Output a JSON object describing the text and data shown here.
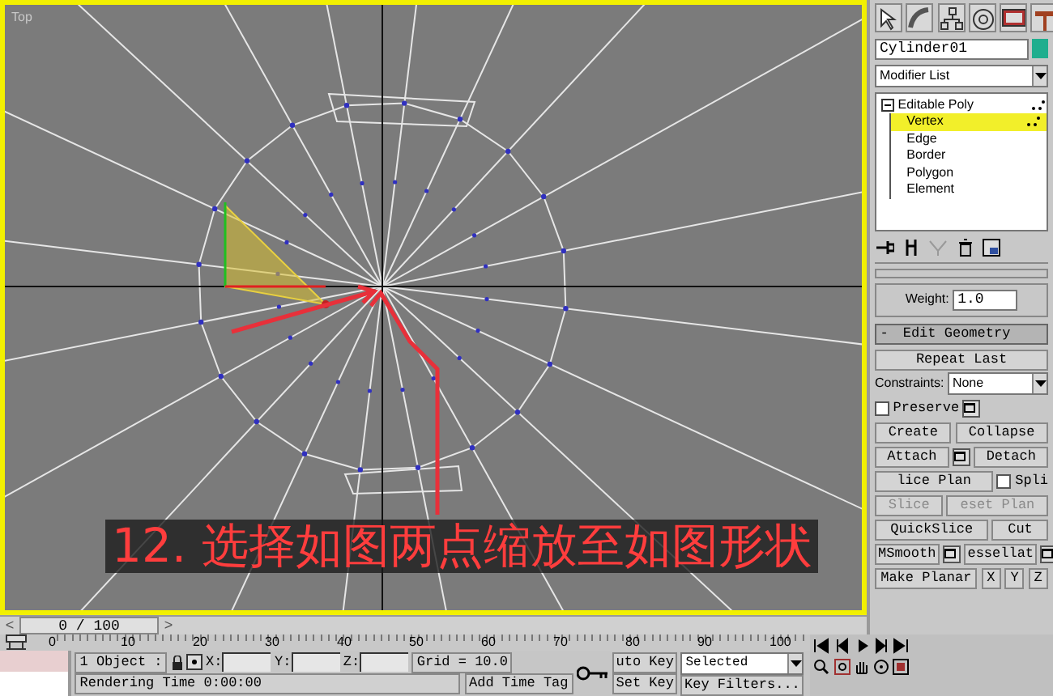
{
  "viewport": {
    "label": "Top",
    "annotation": "12. 选择如图两点缩放至如图形状"
  },
  "time_slider": {
    "prev": "<",
    "position": "0 / 100",
    "next": ">",
    "level": 0
  },
  "command_panel": {
    "object_name": "Cylinder01",
    "modifier_list": "Modifier List",
    "modifier_stack": [
      {
        "label": "Editable Poly",
        "expanded": true,
        "selected": false,
        "children": [
          {
            "label": "Vertex",
            "selected": true
          },
          {
            "label": "Edge",
            "selected": false
          },
          {
            "label": "Border",
            "selected": false
          },
          {
            "label": "Polygon",
            "selected": false
          },
          {
            "label": "Element",
            "selected": false
          }
        ]
      }
    ],
    "weight": {
      "label": "Weight:",
      "value": "1.0"
    },
    "edit_geometry": {
      "collapse_sign": "-",
      "title": "Edit Geometry",
      "rows": [
        [
          {
            "kind": "button",
            "label": "Repeat Last",
            "disabled": false
          }
        ],
        [
          {
            "kind": "label",
            "label": "Constraints:"
          },
          {
            "kind": "dropdown",
            "label": "None"
          }
        ],
        [
          {
            "kind": "checkbox",
            "label": "Preserve",
            "checked": false
          },
          {
            "kind": "settings"
          }
        ],
        [
          {
            "kind": "button",
            "label": "Create",
            "disabled": false
          },
          {
            "kind": "button",
            "label": "Collapse",
            "disabled": false
          }
        ],
        [
          {
            "kind": "button",
            "label": "Attach",
            "disabled": false
          },
          {
            "kind": "settings"
          },
          {
            "kind": "button",
            "label": "Detach",
            "disabled": false
          }
        ],
        [
          {
            "kind": "button",
            "label": "lice Plan",
            "disabled": false
          },
          {
            "kind": "checkbox",
            "label": "Spli",
            "checked": false
          }
        ],
        [
          {
            "kind": "button",
            "label": "Slice",
            "disabled": true
          },
          {
            "kind": "button",
            "label": "eset Plan",
            "disabled": true
          }
        ],
        [
          {
            "kind": "button",
            "label": "QuickSlice",
            "disabled": false
          },
          {
            "kind": "button",
            "label": "Cut",
            "disabled": false
          }
        ],
        [
          {
            "kind": "button",
            "label": "MSmooth",
            "disabled": false
          },
          {
            "kind": "settings"
          },
          {
            "kind": "button",
            "label": "essellat",
            "disabled": false
          },
          {
            "kind": "settings"
          }
        ],
        [
          {
            "kind": "button",
            "label": "Make Planar",
            "disabled": false
          },
          {
            "kind": "button",
            "label": "X",
            "disabled": false
          },
          {
            "kind": "button",
            "label": "Y",
            "disabled": false
          },
          {
            "kind": "button",
            "label": "Z",
            "disabled": false
          }
        ]
      ]
    }
  },
  "track_bar": {
    "ticks": [
      "0",
      "10",
      "20",
      "30",
      "40",
      "50",
      "60",
      "70",
      "80",
      "90",
      "100"
    ]
  },
  "status_bar": {
    "selection": "1 Object :",
    "coords": [
      "X:",
      "Y:",
      "Z:"
    ],
    "grid": "Grid = 10.0",
    "prompt": "Rendering Time  0:00:00",
    "time_tag": "Add Time Tag",
    "auto_key": "uto Key",
    "set_key": "Set Key",
    "key_mode": "Selected",
    "key_filters": "Key Filters..."
  }
}
